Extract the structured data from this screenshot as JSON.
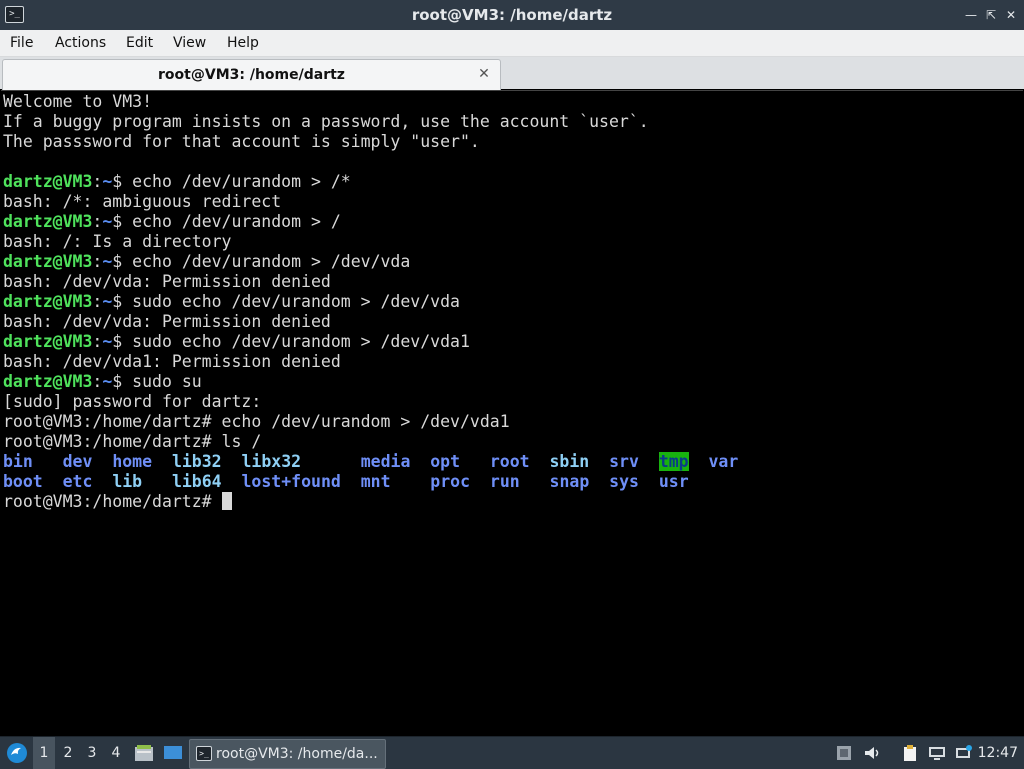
{
  "window": {
    "title": "root@VM3: /home/dartz",
    "controls": [
      "minimize-icon",
      "maximize-icon",
      "close-icon"
    ]
  },
  "menubar": {
    "items": [
      "File",
      "Actions",
      "Edit",
      "View",
      "Help"
    ]
  },
  "tabs": [
    {
      "label": "root@VM3: /home/dartz",
      "close_icon": "close-icon"
    }
  ],
  "terminal": {
    "lines": [
      {
        "type": "text",
        "text": "Welcome to VM3!"
      },
      {
        "type": "text",
        "text": "If a buggy program insists on a password, use the account `user`."
      },
      {
        "type": "text",
        "text": "The passsword for that account is simply \"user\"."
      },
      {
        "type": "blank"
      },
      {
        "type": "prompt",
        "user": "dartz@VM3",
        "path": "~",
        "suffix": "$ ",
        "cmd": "echo /dev/urandom > /*"
      },
      {
        "type": "text",
        "text": "bash: /*: ambiguous redirect"
      },
      {
        "type": "prompt",
        "user": "dartz@VM3",
        "path": "~",
        "suffix": "$ ",
        "cmd": "echo /dev/urandom > /"
      },
      {
        "type": "text",
        "text": "bash: /: Is a directory"
      },
      {
        "type": "prompt",
        "user": "dartz@VM3",
        "path": "~",
        "suffix": "$ ",
        "cmd": "echo /dev/urandom > /dev/vda"
      },
      {
        "type": "text",
        "text": "bash: /dev/vda: Permission denied"
      },
      {
        "type": "prompt",
        "user": "dartz@VM3",
        "path": "~",
        "suffix": "$ ",
        "cmd": "sudo echo /dev/urandom > /dev/vda"
      },
      {
        "type": "text",
        "text": "bash: /dev/vda: Permission denied"
      },
      {
        "type": "prompt",
        "user": "dartz@VM3",
        "path": "~",
        "suffix": "$ ",
        "cmd": "sudo echo /dev/urandom > /dev/vda1"
      },
      {
        "type": "text",
        "text": "bash: /dev/vda1: Permission denied"
      },
      {
        "type": "prompt",
        "user": "dartz@VM3",
        "path": "~",
        "suffix": "$ ",
        "cmd": "sudo su"
      },
      {
        "type": "text",
        "text": "[sudo] password for dartz:"
      },
      {
        "type": "text",
        "text": "root@VM3:/home/dartz# echo /dev/urandom > /dev/vda1"
      },
      {
        "type": "text",
        "text": "root@VM3:/home/dartz# ls /"
      },
      {
        "type": "ls",
        "entries": [
          {
            "name": "bin",
            "col": 0,
            "style": "dirs"
          },
          {
            "name": "dev",
            "col": 6,
            "style": "dirs"
          },
          {
            "name": "home",
            "col": 11,
            "style": "dirs"
          },
          {
            "name": "lib32",
            "col": 17,
            "style": "dir-hl"
          },
          {
            "name": "libx32",
            "col": 24,
            "style": "dir-hl"
          },
          {
            "name": "media",
            "col": 36,
            "style": "dirs"
          },
          {
            "name": "opt",
            "col": 43,
            "style": "dirs"
          },
          {
            "name": "root",
            "col": 49,
            "style": "dirs"
          },
          {
            "name": "sbin",
            "col": 55,
            "style": "dir-hl"
          },
          {
            "name": "srv",
            "col": 61,
            "style": "dirs"
          },
          {
            "name": "tmp",
            "col": 66,
            "style": "tmp"
          },
          {
            "name": "var",
            "col": 71,
            "style": "dirs"
          }
        ]
      },
      {
        "type": "ls",
        "entries": [
          {
            "name": "boot",
            "col": 0,
            "style": "dirs"
          },
          {
            "name": "etc",
            "col": 6,
            "style": "dirs"
          },
          {
            "name": "lib",
            "col": 11,
            "style": "dir-hl"
          },
          {
            "name": "lib64",
            "col": 17,
            "style": "dir-hl"
          },
          {
            "name": "lost+found",
            "col": 24,
            "style": "dirs"
          },
          {
            "name": "mnt",
            "col": 36,
            "style": "dirs"
          },
          {
            "name": "proc",
            "col": 43,
            "style": "dirs"
          },
          {
            "name": "run",
            "col": 49,
            "style": "dirs"
          },
          {
            "name": "snap",
            "col": 55,
            "style": "dirs"
          },
          {
            "name": "sys",
            "col": 61,
            "style": "dirs"
          },
          {
            "name": "usr",
            "col": 66,
            "style": "dirs"
          }
        ]
      },
      {
        "type": "cursor",
        "text": "root@VM3:/home/dartz# "
      }
    ]
  },
  "taskbar": {
    "start_icon": "lubuntu-start-icon",
    "workspaces": [
      "1",
      "2",
      "3",
      "4"
    ],
    "active_workspace": "1",
    "quicklaunch": [
      "file-manager-icon",
      "show-desktop-icon"
    ],
    "task_label": "root@VM3: /home/da...",
    "tray": [
      "removable-media-icon",
      "volume-icon",
      "clipboard-icon",
      "network-icon",
      "update-notifier-icon"
    ],
    "clock": "12:47"
  },
  "colors": {
    "prompt_user": "#4fe35c",
    "prompt_path": "#5b8ff5",
    "dir": "#6f8ff7",
    "dir_link": "#8fd0f5",
    "tmp_bg": "#18b20f"
  }
}
